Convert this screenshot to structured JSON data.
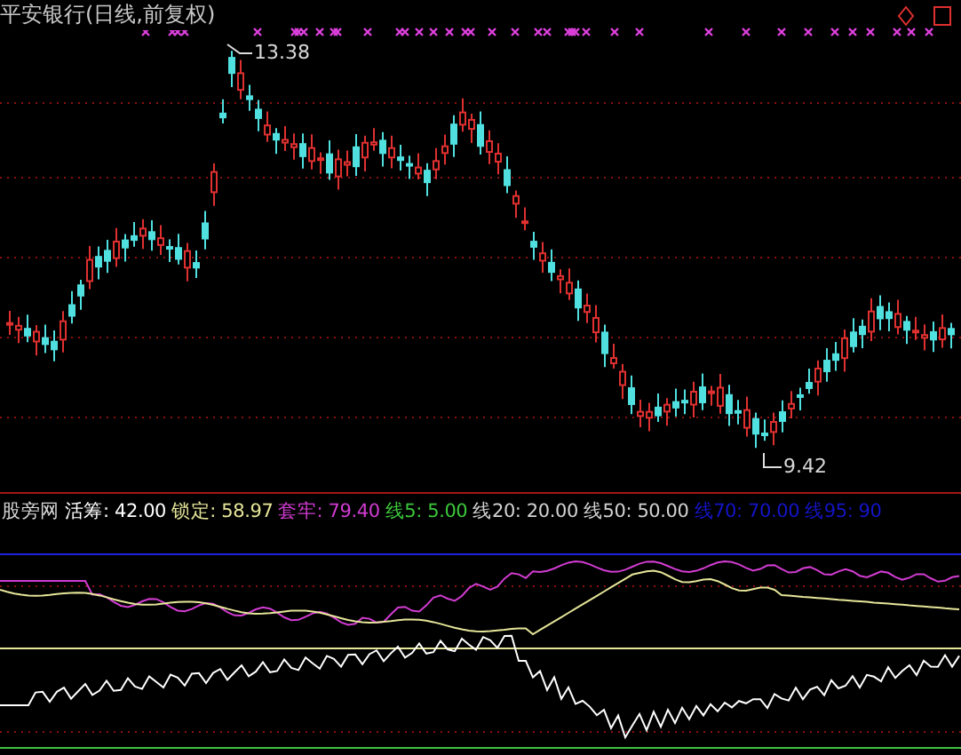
{
  "title": "平安银行(日线,前复权)",
  "chart": {
    "high_label": "13.38",
    "low_label": "9.42"
  },
  "indicator": {
    "name": "股旁网",
    "values": [
      {
        "text": "活筹: 42.00",
        "color": "#ffffff"
      },
      {
        "text": "锁定: 58.97",
        "color": "#e6e69a"
      },
      {
        "text": "套牢: 79.40",
        "color": "#d23cd2"
      },
      {
        "text": "线5: 5.00",
        "color": "#3cc83c"
      },
      {
        "text": "线20: 20.00",
        "color": "#d2d2d2"
      },
      {
        "text": "线50: 50.00",
        "color": "#d2d2d2"
      },
      {
        "text": "线70: 70.00",
        "color": "#1414c8"
      },
      {
        "text": "线95: 90",
        "color": "#1414c8"
      }
    ]
  }
}
